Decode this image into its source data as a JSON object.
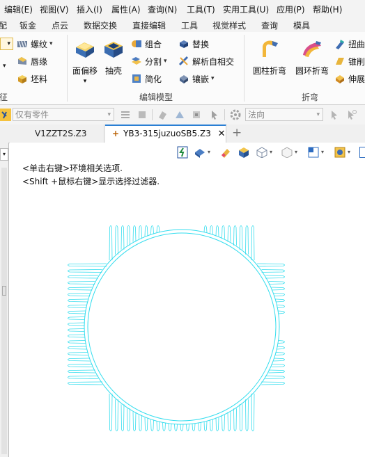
{
  "menu": [
    "编辑(E)",
    "视图(V)",
    "插入(I)",
    "属性(A)",
    "查询(N)",
    "工具(T)",
    "实用工具(U)",
    "应用(P)",
    "帮助(H)"
  ],
  "ribbon_tabs": [
    "配",
    "钣金",
    "点云",
    "数据交换",
    "直接编辑",
    "工具",
    "视觉样式",
    "查询",
    "模具"
  ],
  "ribbon": {
    "col1": [
      "螺纹",
      "唇缘",
      "坯料"
    ],
    "col1_group_fragment": "征",
    "large": [
      "面偏移",
      "抽壳"
    ],
    "col3": [
      "组合",
      "分割",
      "简化"
    ],
    "col4": [
      "替换",
      "解析自相交",
      "镶嵌"
    ],
    "edit_group_label": "编辑模型",
    "bend_large": [
      "圆柱折弯",
      "圆环折弯"
    ],
    "col6": [
      "扭曲",
      "锥削",
      "伸展"
    ],
    "bend_group_label": "折弯"
  },
  "filter": {
    "selection_filter": "仅有零件",
    "direction": "法向"
  },
  "doc_tabs": [
    {
      "label": "V1ZZT2S.Z3",
      "active": false
    },
    {
      "label": "YB3-315juzuoSB5.Z3",
      "active": true
    }
  ],
  "hints": [
    "<单击右键>环境相关选项.",
    "<Shift +鼠标右键>显示选择过滤器."
  ],
  "colors": {
    "wireframe": "#33ddee",
    "active_tab_marker": "#d17b00",
    "accent": "#2a7fd4"
  }
}
